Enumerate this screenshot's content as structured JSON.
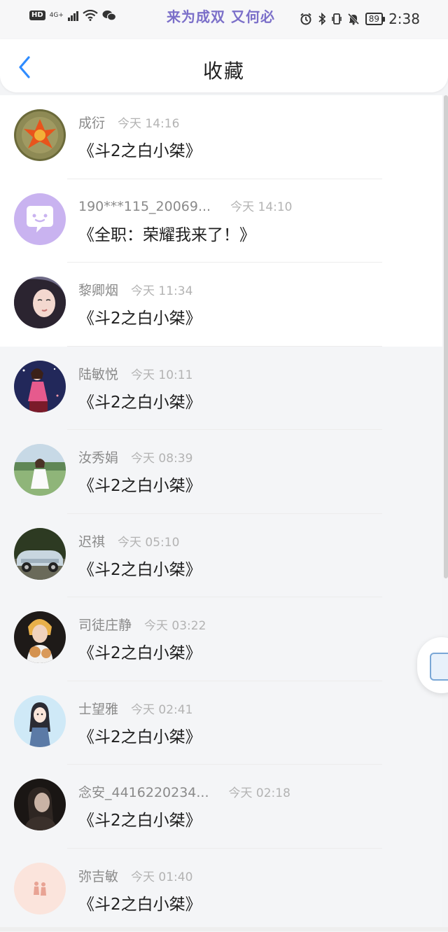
{
  "status_bar": {
    "hd_label": "HD",
    "network_label": "4G+",
    "marquee_text": "来为成双 又何必",
    "battery": "89",
    "time": "2:38"
  },
  "header": {
    "title": "收藏"
  },
  "items": [
    {
      "user": "成衍",
      "time": "今天 14:16",
      "title": "《斗2之白小桀》"
    },
    {
      "user": "190***115_20069...",
      "time": "今天 14:10",
      "title": "《全职：荣耀我来了！》"
    },
    {
      "user": "黎卿烟",
      "time": "今天 11:34",
      "title": "《斗2之白小桀》"
    },
    {
      "user": "陆敏悦",
      "time": "今天 10:11",
      "title": "《斗2之白小桀》"
    },
    {
      "user": "汝秀娟",
      "time": "今天 08:39",
      "title": "《斗2之白小桀》"
    },
    {
      "user": "迟祺",
      "time": "今天 05:10",
      "title": "《斗2之白小桀》"
    },
    {
      "user": "司徒庄静",
      "time": "今天 03:22",
      "title": "《斗2之白小桀》"
    },
    {
      "user": "士望雅",
      "time": "今天 02:41",
      "title": "《斗2之白小桀》"
    },
    {
      "user": "念安_4416220234...",
      "time": "今天 02:18",
      "title": "《斗2之白小桀》"
    },
    {
      "user": "弥吉敏",
      "time": "今天 01:40",
      "title": "《斗2之白小桀》"
    }
  ],
  "colors": {
    "accent": "#2f8cff",
    "username": "#8a8a8a",
    "timestamp": "#b3b3b3",
    "marquee": "#7b6fc9"
  }
}
